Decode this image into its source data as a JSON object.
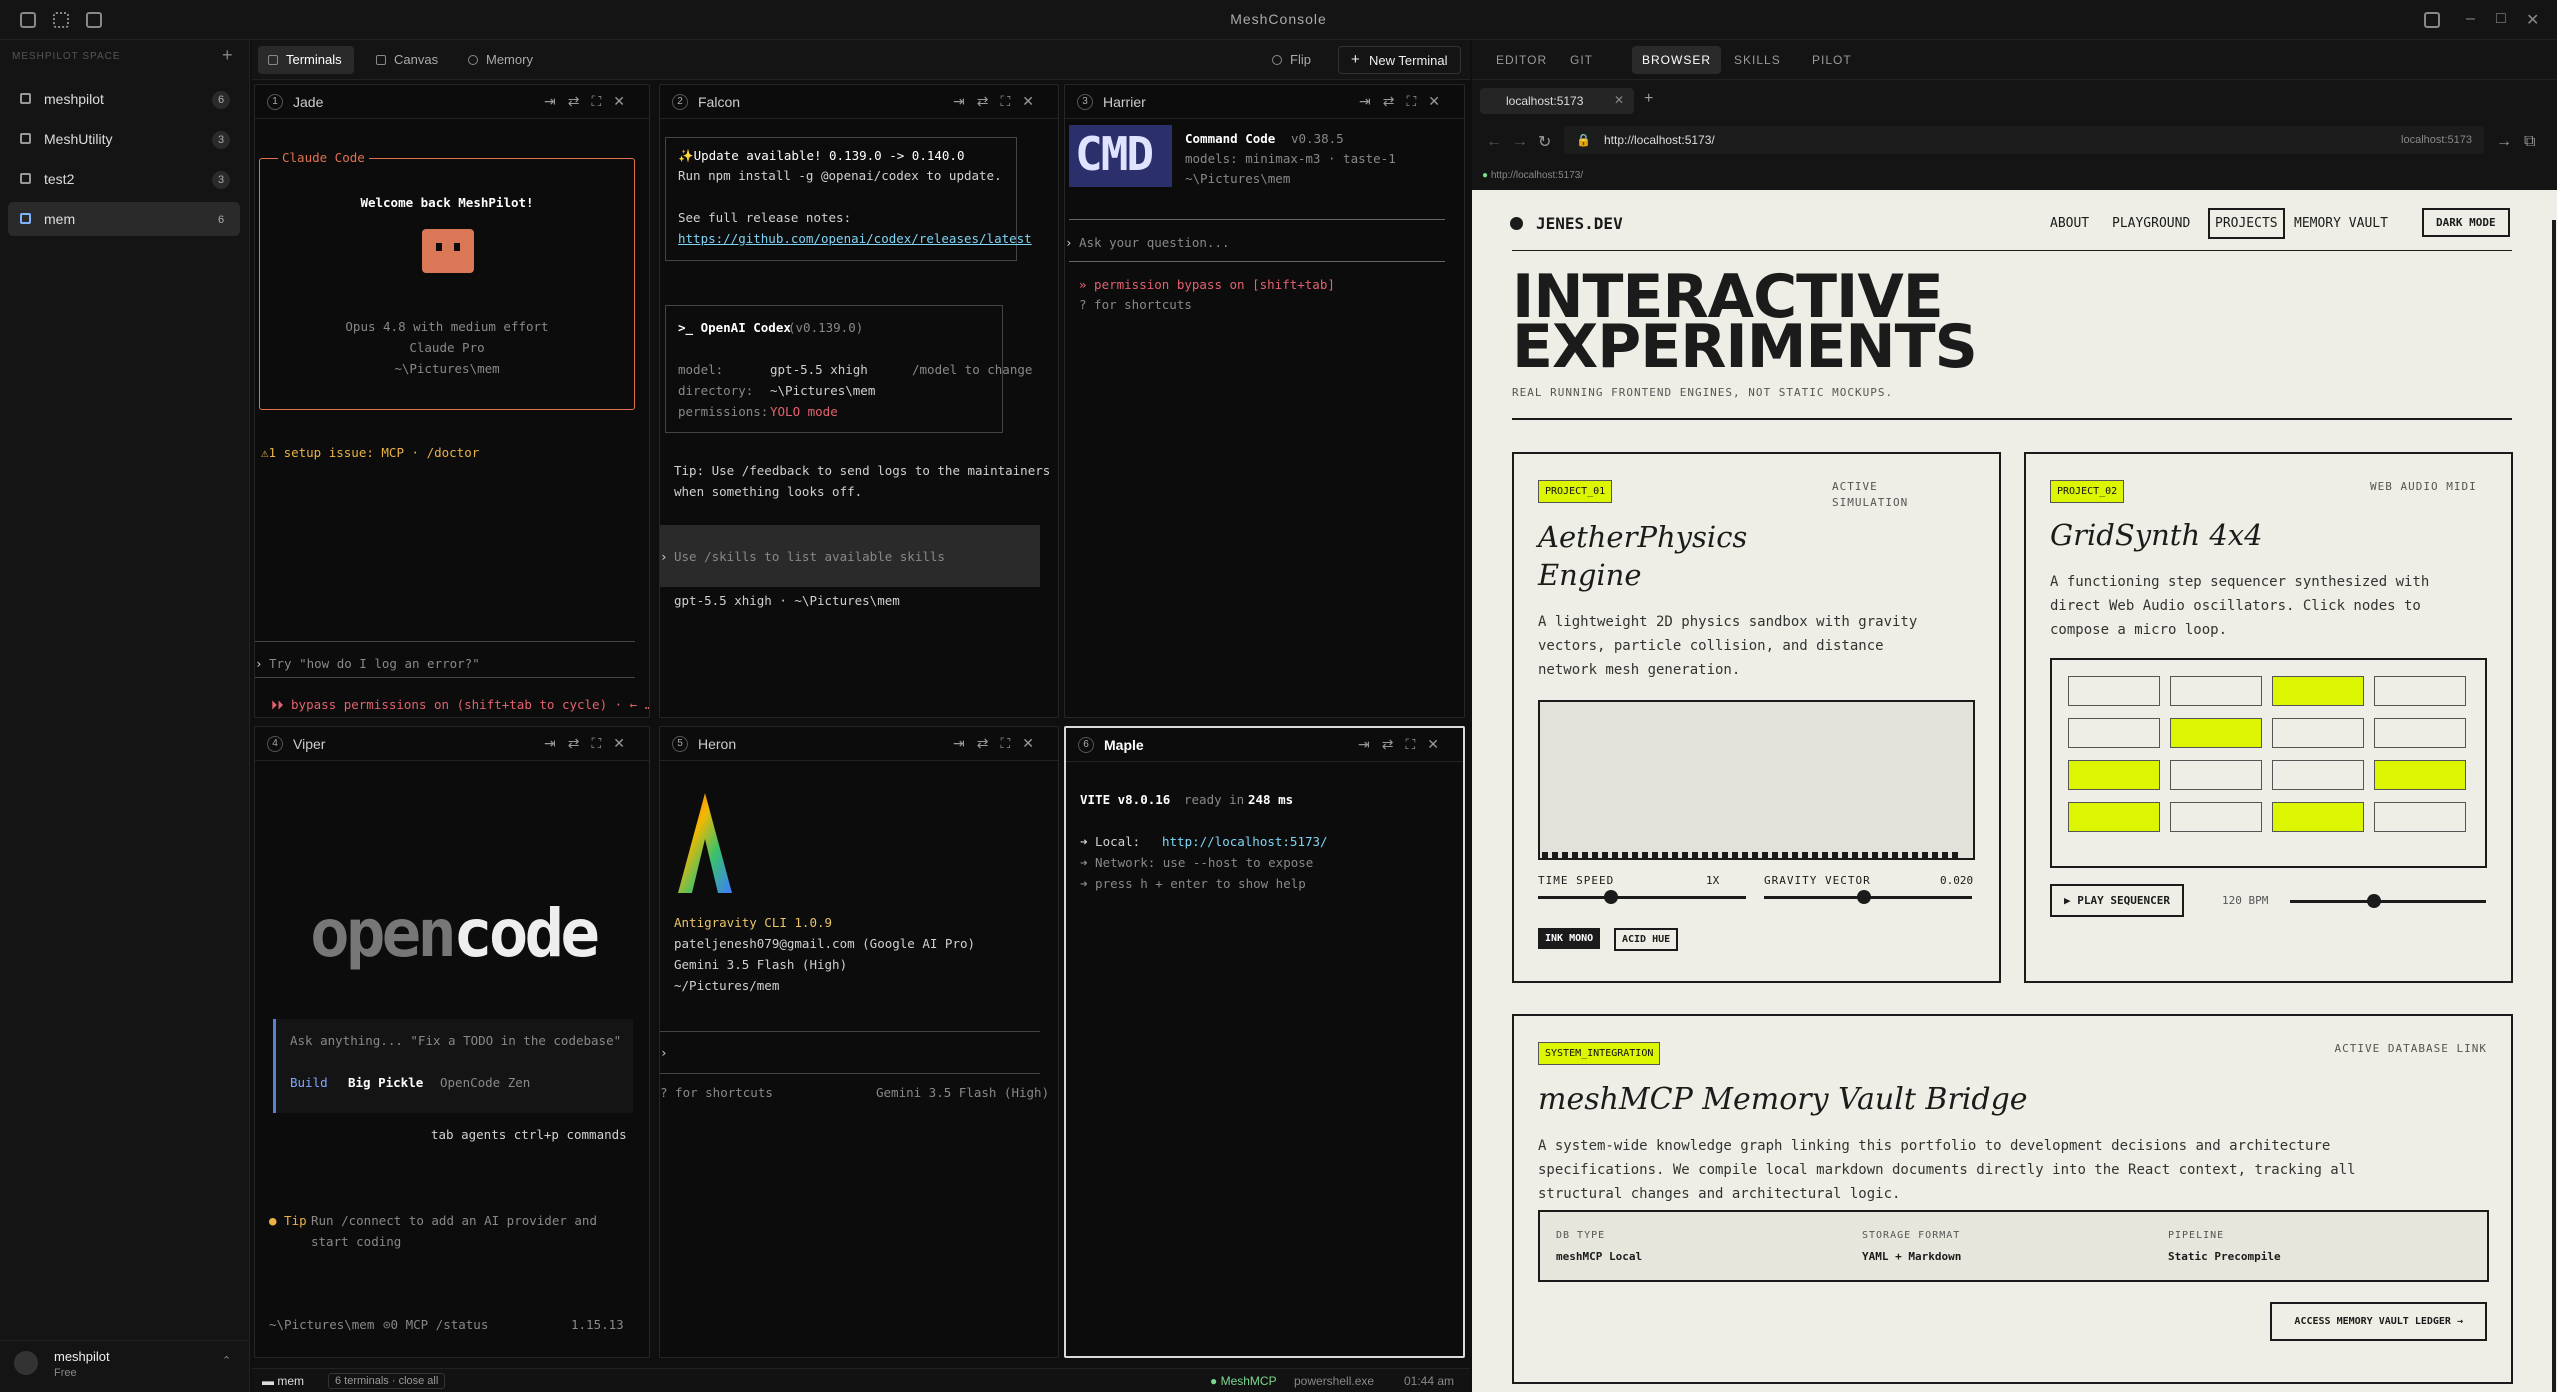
{
  "app": {
    "title": "MeshConsole"
  },
  "sidebar": {
    "space_label": "MESHPILOT SPACE",
    "workspaces": [
      {
        "name": "meshpilot",
        "count": "6"
      },
      {
        "name": "MeshUtility",
        "count": "3"
      },
      {
        "name": "test2",
        "count": "3"
      },
      {
        "name": "mem",
        "count": "6"
      }
    ],
    "user": {
      "name": "meshpilot",
      "plan": "Free"
    }
  },
  "tabs": {
    "terminals": "Terminals",
    "canvas": "Canvas",
    "memory": "Memory",
    "flip": "Flip",
    "new_terminal": "New Terminal"
  },
  "panes": [
    {
      "num": "1",
      "name": "Jade"
    },
    {
      "num": "2",
      "name": "Falcon"
    },
    {
      "num": "3",
      "name": "Harrier"
    },
    {
      "num": "4",
      "name": "Viper"
    },
    {
      "num": "5",
      "name": "Heron"
    },
    {
      "num": "6",
      "name": "Maple"
    }
  ],
  "jade": {
    "box_title": "Claude Code",
    "welcome": "Welcome back MeshPilot!",
    "model": "Opus 4.8 with medium effort",
    "plan": "Claude Pro",
    "path": "~\\Pictures\\mem",
    "issue": "⚠1 setup issue: MCP · /doctor",
    "prompt": "Try \"how do I log an error?\"",
    "footer": "⏵⏵ bypass permissions on (shift+tab to cycle) · ← …"
  },
  "falcon": {
    "update": "✨Update available! 0.139.0 -> 0.140.0",
    "run": "Run npm install -g @openai/codex to update.",
    "notes": "See full release notes:",
    "link": "https://github.com/openai/codex/releases/latest",
    "codex_title": ">_ OpenAI Codex",
    "codex_ver": "(v0.139.0)",
    "model_k": "model:",
    "model_v": "gpt-5.5 xhigh",
    "model_hint": "/model to change",
    "dir_k": "directory:",
    "dir_v": "~\\Pictures\\mem",
    "perm_k": "permissions:",
    "perm_v": "YOLO mode",
    "tip1": "Tip: Use /feedback to send logs to the maintainers",
    "tip2": "when something looks off.",
    "input": "Use /skills to list available skills",
    "footer": "gpt-5.5 xhigh · ~\\Pictures\\mem"
  },
  "harrier": {
    "logo": "CMD",
    "name": "Command Code",
    "ver": "v0.38.5",
    "models": "models: minimax-m3 · taste-1",
    "path": "~\\Pictures\\mem",
    "prompt": "Ask your question...",
    "perm": "» permission bypass on [shift+tab]",
    "hint": "? for shortcuts"
  },
  "viper": {
    "logo_a": "open",
    "logo_b": "code",
    "prompt": "Ask anything... \"Fix a TODO in the codebase\"",
    "build": "Build",
    "model": "Big Pickle",
    "provider": "OpenCode Zen",
    "keys": "tab agents  ctrl+p commands",
    "tip_a": "● Tip",
    "tip_b": "Run /connect to add an AI provider and",
    "tip_c": "start coding",
    "foot_path": "~\\Pictures\\mem",
    "foot_mcp": "⊙0 MCP /status",
    "foot_ver": "1.15.13"
  },
  "heron": {
    "name": "Antigravity CLI 1.0.9",
    "email": "pateljenesh079@gmail.com (Google AI Pro)",
    "model": "Gemini 3.5 Flash (High)",
    "path": "~/Pictures/mem",
    "hint": "? for shortcuts",
    "model_r": "Gemini 3.5 Flash (High)"
  },
  "maple": {
    "vite": "VITE v8.0.16",
    "ready": "ready in",
    "ms": "248 ms",
    "local_k": "➜  Local:",
    "local_v": "http://localhost:5173/",
    "net": "➜  Network: use --host to expose",
    "help": "➜  press h + enter to show help"
  },
  "statusbar": {
    "ws": "mem",
    "count": "6 terminals · close all",
    "mcp": "● MeshMCP",
    "shell": "powershell.exe",
    "time": "01:44 am"
  },
  "browser": {
    "tabs": [
      "EDITOR",
      "GIT",
      "BROWSER",
      "SKILLS",
      "PILOT"
    ],
    "page_tab": "localhost:5173",
    "url": "http://localhost:5173/",
    "url_right": "localhost:5173",
    "status_url": "http://localhost:5173/"
  },
  "site": {
    "brand": "JENES.DEV",
    "nav": [
      "ABOUT",
      "PLAYGROUND",
      "PROJECTS",
      "MEMORY VAULT"
    ],
    "dark": "DARK MODE",
    "h1a": "INTERACTIVE",
    "h1b": "EXPERIMENTS",
    "sub": "REAL RUNNING FRONTEND ENGINES, NOT STATIC MOCKUPS.",
    "p1": {
      "tag": "PROJECT_01",
      "status_a": "ACTIVE",
      "status_b": "SIMULATION",
      "title_a": "AetherPhysics",
      "title_b": "Engine",
      "desc": [
        "A lightweight 2D physics sandbox with gravity",
        "vectors, particle collision, and distance",
        "network mesh generation."
      ],
      "time": "TIME SPEED",
      "time_v": "1X",
      "grav": "GRAVITY VECTOR",
      "grav_v": "0.020",
      "btn1": "INK MONO",
      "btn2": "ACID HUE",
      "time_level": 0.35,
      "grav_level": 0.48
    },
    "p2": {
      "tag": "PROJECT_02",
      "status": "WEB AUDIO MIDI",
      "title": "GridSynth 4x4",
      "desc": [
        "A functioning step sequencer synthesized with",
        "direct Web Audio oscillators. Click nodes to",
        "compose a micro loop."
      ],
      "grid": [
        [
          0,
          0,
          1,
          0
        ],
        [
          0,
          1,
          0,
          0
        ],
        [
          1,
          0,
          0,
          1
        ],
        [
          1,
          0,
          1,
          0
        ]
      ],
      "play": "▶ PLAY SEQUENCER",
      "bpm": "120 BPM",
      "bpm_level": 0.43
    },
    "p3": {
      "tag": "SYSTEM_INTEGRATION",
      "status": "ACTIVE DATABASE LINK",
      "title": "meshMCP Memory Vault Bridge",
      "desc": [
        "A system-wide knowledge graph linking this portfolio to development decisions and architecture",
        "specifications. We compile local markdown documents directly into the React context, tracking all",
        "structural changes and architectural logic."
      ],
      "k1": "DB TYPE",
      "v1": "meshMCP Local",
      "k2": "STORAGE FORMAT",
      "v2": "YAML + Markdown",
      "k3": "PIPELINE",
      "v3": "Static Precompile",
      "btn": "ACCESS MEMORY VAULT LEDGER →"
    }
  }
}
